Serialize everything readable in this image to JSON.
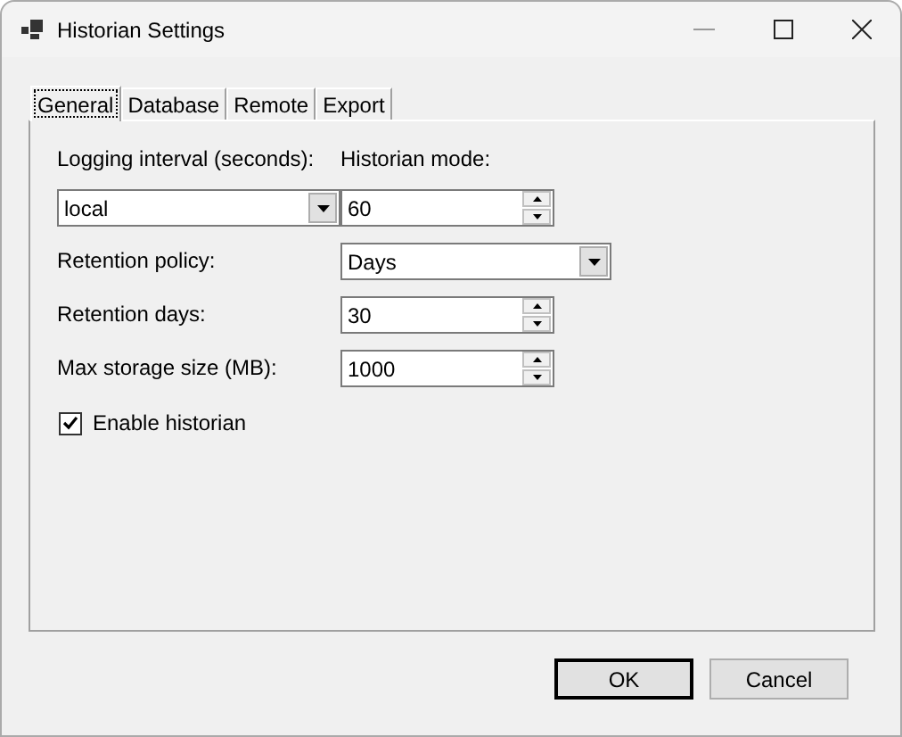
{
  "window": {
    "title": "Historian Settings"
  },
  "tabs": [
    {
      "label": "General",
      "selected": true
    },
    {
      "label": "Database",
      "selected": false
    },
    {
      "label": "Remote",
      "selected": false
    },
    {
      "label": "Export",
      "selected": false
    }
  ],
  "top_row": [
    {
      "label": "Logging interval (seconds):",
      "kind": "combo",
      "value": "local"
    },
    {
      "label": "Historian mode:",
      "kind": "spinner",
      "value": "60"
    }
  ],
  "rows": [
    {
      "label": "Retention policy:",
      "kind": "combo",
      "value": "Days"
    },
    {
      "label": "Retention days:",
      "kind": "spinner",
      "value": "30"
    },
    {
      "label": "Max storage size (MB):",
      "kind": "spinner",
      "value": "1000"
    }
  ],
  "checkbox": {
    "label": "Enable historian",
    "checked": true
  },
  "buttons": [
    {
      "label": "OK",
      "default": true
    },
    {
      "label": "Cancel",
      "default": false
    }
  ]
}
